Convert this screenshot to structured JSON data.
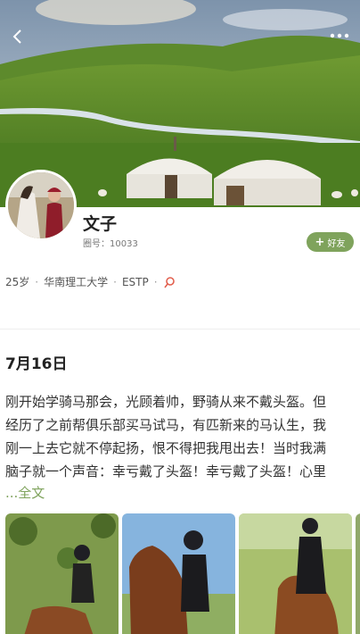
{
  "header": {
    "back_icon": "chevron-left-icon",
    "more_icon": "more-dots-icon"
  },
  "profile": {
    "name": "文子",
    "id_line": "圈号：10033",
    "friend_button": "好友",
    "meta": {
      "age": "25岁",
      "school": "华南理工大学",
      "mbti": "ESTP",
      "separator": "·"
    },
    "accent_color": "#7fa35c"
  },
  "post": {
    "date": "7月16日",
    "lines": [
      "刚开始学骑马那会，光顾着帅，野骑从来不戴头盔。但",
      "经历了之前帮俱乐部买马试马，有匹新来的马认生，我",
      "刚一上去它就不停起扬，恨不得把我甩出去！当时我满",
      "脑子就一个声音：幸亏戴了头盔！幸亏戴了头盔！心里"
    ],
    "full_text_link": "...全文"
  }
}
